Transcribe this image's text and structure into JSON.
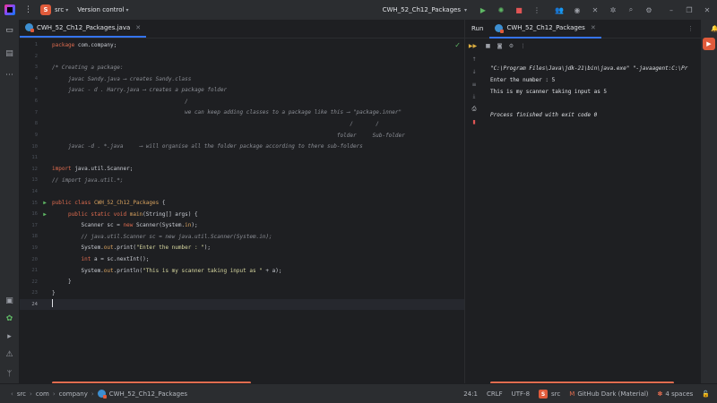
{
  "titlebar": {
    "project_badge": "S",
    "project_name": "src",
    "vcs_label": "Version control",
    "run_config": "CWH_52_Ch12_Packages"
  },
  "editor": {
    "tab_label": "CWH_52_Ch12_Packages.java",
    "current_line": 24,
    "lines": [
      {
        "n": "1",
        "html": "<span class='kw'>package</span> <span class='pl'>com.company;</span>"
      },
      {
        "n": "2",
        "html": ""
      },
      {
        "n": "3",
        "html": "<span class='cm'>/* Creating a package:</span>"
      },
      {
        "n": "4",
        "html": "<span class='cm'>     javac Sandy.java ⟶ creates Sandy.class</span>"
      },
      {
        "n": "5",
        "html": "<span class='cm'>     javac - d . Harry.java ⟶ creates a package folder</span>"
      },
      {
        "n": "6",
        "html": "<span class='cm'>                                         /</span>"
      },
      {
        "n": "7",
        "html": "<span class='cm'>                                         we can keep adding classes to a package like this ⟶ \"package.inner\"</span>"
      },
      {
        "n": "8",
        "html": "<span class='cm'>                                                                                            /       /</span>"
      },
      {
        "n": "9",
        "html": "<span class='cm'>                                                                                        folder     Sub-folder</span>"
      },
      {
        "n": "10",
        "html": "<span class='cm'>     javac -d . *.java     ⟶ will organise all the folder package according to there sub-folders</span>"
      },
      {
        "n": "11",
        "html": ""
      },
      {
        "n": "12",
        "html": "<span class='kw'>import</span> <span class='pl'>java.util.Scanner;</span>"
      },
      {
        "n": "13",
        "html": "<span class='cm'>// import java.util.*;</span>"
      },
      {
        "n": "14",
        "html": ""
      },
      {
        "n": "15",
        "html": "<span class='kw'>public class</span> <span class='cl'>CWH_52_Ch12_Packages</span> <span class='pl'>{</span>",
        "run": true
      },
      {
        "n": "16",
        "html": "<span class='kw'>     public static void</span> <span class='mt'>main</span><span class='pl'>(String[] args) {</span>",
        "run": true
      },
      {
        "n": "17",
        "html": "<span class='pl'>         Scanner sc = </span><span class='kw'>new</span><span class='pl'> Scanner(System.</span><span class='mt'>in</span><span class='pl'>);</span>"
      },
      {
        "n": "18",
        "html": "<span class='cm'>         // java.util.Scanner sc = new java.util.Scanner(System.in);</span>"
      },
      {
        "n": "19",
        "html": "<span class='pl'>         System.</span><span class='mt'>out</span><span class='pl'>.print(</span><span class='st'>\"Enter the number : \"</span><span class='pl'>);</span>"
      },
      {
        "n": "20",
        "html": "<span class='kw'>         int</span><span class='pl'> a = sc.nextInt();</span>"
      },
      {
        "n": "21",
        "html": "<span class='pl'>         System.</span><span class='mt'>out</span><span class='pl'>.println(</span><span class='st'>\"This is my scanner taking input as \"</span><span class='pl'> + a);</span>"
      },
      {
        "n": "22",
        "html": "<span class='pl'>     }</span>"
      },
      {
        "n": "23",
        "html": "<span class='pl'>}</span>"
      },
      {
        "n": "24",
        "html": "<span class='caret'></span>"
      }
    ]
  },
  "run_panel": {
    "title": "Run",
    "tab_label": "CWH_52_Ch12_Packages",
    "console": [
      {
        "text": "\"C:\\Program Files\\Java\\jdk-21\\bin\\java.exe\" \"-javaagent:C:\\Pr",
        "italic": true
      },
      {
        "text": "Enter the number : 5",
        "italic": false
      },
      {
        "text": "This is my scanner taking input as 5",
        "italic": false
      },
      {
        "text": "",
        "italic": false
      },
      {
        "text": "Process finished with exit code 0",
        "italic": true
      }
    ]
  },
  "statusbar": {
    "breadcrumbs": [
      "src",
      "com",
      "company",
      "CWH_52_Ch12_Packages"
    ],
    "position": "24:1",
    "line_ending": "CRLF",
    "encoding": "UTF-8",
    "project_badge": "S",
    "project": "src",
    "theme": "GitHub Dark (Material)",
    "indent": "4 spaces"
  },
  "colors": {
    "accent": "#3574f0",
    "keyword": "#e06c4f",
    "run_green": "#5fb865",
    "background": "#1e1f22",
    "panel": "#2b2d30"
  }
}
